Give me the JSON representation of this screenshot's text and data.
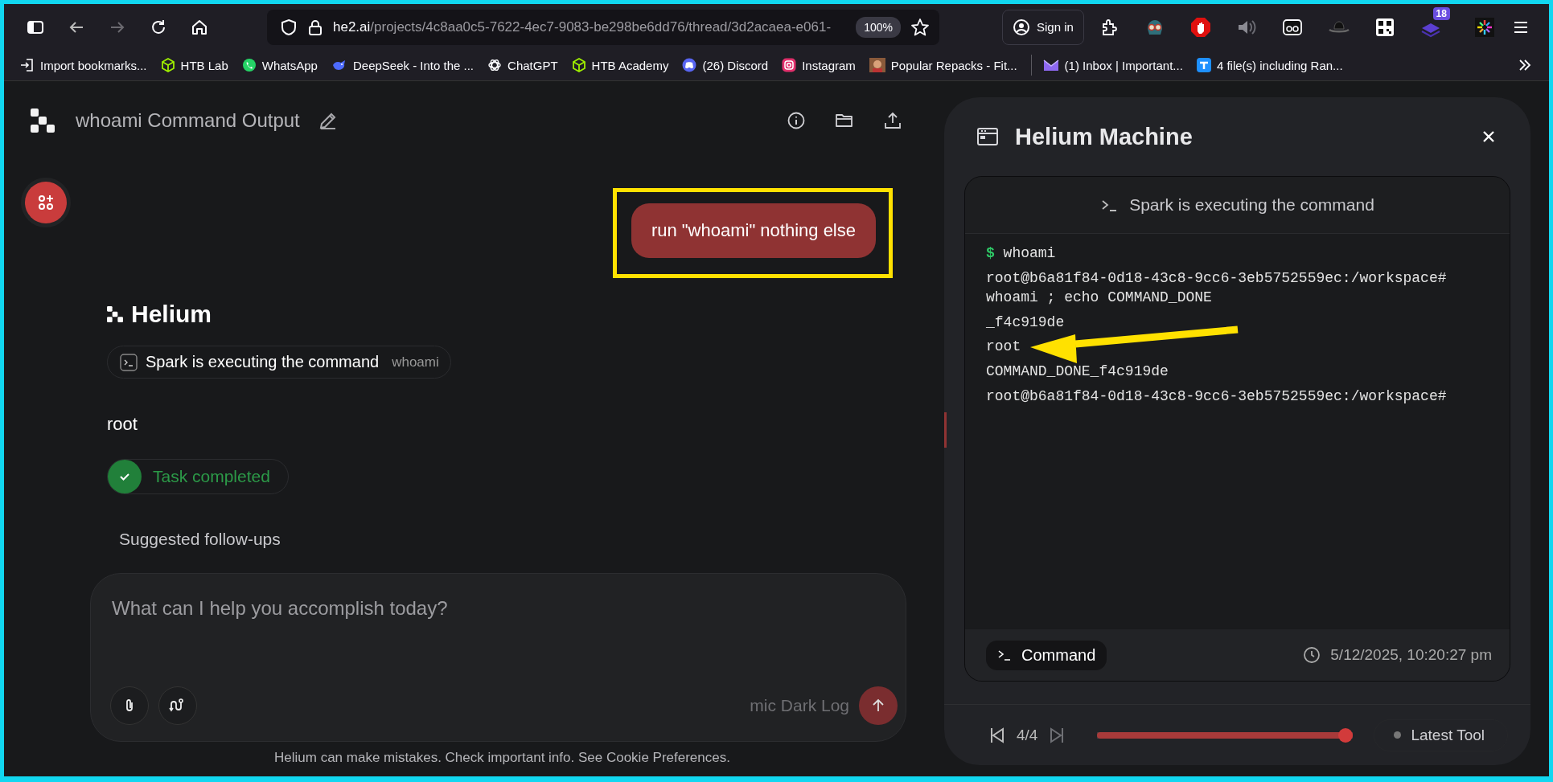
{
  "browser": {
    "back_disabled": false,
    "forward_disabled": true,
    "url_host": "he2.ai",
    "url_path": "/projects/4c8aa0c5-7622-4ec7-9083-be298be6dd76/thread/3d2acaea-e061-",
    "zoom": "100%",
    "sign_in": "Sign in",
    "extensions": [
      {
        "kind": "puzzle"
      },
      {
        "kind": "mask"
      },
      {
        "kind": "stop"
      },
      {
        "kind": "speaker"
      },
      {
        "kind": "cassette"
      },
      {
        "kind": "hat"
      },
      {
        "kind": "qr"
      },
      {
        "kind": "stack",
        "badge": "18"
      },
      {
        "kind": "burst"
      }
    ]
  },
  "bookmarks": [
    {
      "kind": "import",
      "label": "Import bookmarks..."
    },
    {
      "kind": "cube",
      "label": "HTB Lab"
    },
    {
      "kind": "whatsapp",
      "label": "WhatsApp"
    },
    {
      "kind": "whale",
      "label": "DeepSeek - Into the ..."
    },
    {
      "kind": "knot",
      "label": "ChatGPT"
    },
    {
      "kind": "cube",
      "label": "HTB Academy"
    },
    {
      "kind": "discord",
      "label": "(26) Discord"
    },
    {
      "kind": "instagram",
      "label": "Instagram"
    },
    {
      "kind": "thumb",
      "label": "Popular Repacks - Fit..."
    },
    {
      "kind": "separator"
    },
    {
      "kind": "mail",
      "label": "(1) Inbox | Important..."
    },
    {
      "kind": "transfer",
      "label": "4 file(s) including Ran..."
    }
  ],
  "chat": {
    "title": "whoami Command Output",
    "user_message": "run \"whoami\" nothing else",
    "assistant_name": "Helium",
    "tool_chip": {
      "label": "Spark is executing the command",
      "argument": "whoami"
    },
    "result": "root",
    "status": {
      "label": "Task completed",
      "done": true
    },
    "suggested_heading": "Suggested follow-ups",
    "composer": {
      "placeholder": "What can I help you accomplish today?",
      "overlay_text": "mic Dark Log"
    },
    "disclaimer": "Helium can make mistakes. Check important info. See Cookie Preferences."
  },
  "machine": {
    "title": "Helium Machine",
    "terminal_header": "Spark is executing the command",
    "lines": [
      {
        "kind": "prompt",
        "symbol": "$",
        "text": "whoami"
      },
      {
        "kind": "output",
        "text": "root@b6a81f84-0d18-43c8-9cc6-3eb5752559ec:/workspace# whoami ; echo COMMAND_DONE"
      },
      {
        "kind": "output",
        "text": "_f4c919de"
      },
      {
        "kind": "output",
        "text": "root"
      },
      {
        "kind": "output",
        "text": "COMMAND_DONE_f4c919de"
      },
      {
        "kind": "output",
        "text": "root@b6a81f84-0d18-43c8-9cc6-3eb5752559ec:/workspace#"
      }
    ],
    "tool_label": "Command",
    "timestamp": "5/12/2025, 10:20:27 pm",
    "step": "4/4",
    "next_disabled": true,
    "progress": {
      "level": 1.0
    },
    "latest_label": "Latest Tool"
  }
}
